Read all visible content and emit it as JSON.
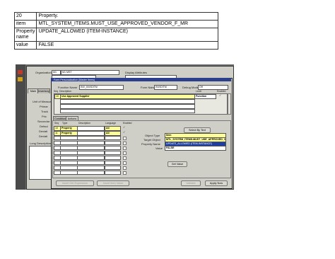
{
  "info_table": [
    {
      "key": "20",
      "value": "Property."
    },
    {
      "key": "item",
      "value": "MTL_SYSTEM_ITEMS.MUST_USE_APPROVED_VENDOR_F_MR"
    },
    {
      "key": "Property name",
      "value": "UPDATE_ALLOWED (ITEM-INSTANCE)"
    },
    {
      "key": "value",
      "value": "FALSE"
    }
  ],
  "back_form": {
    "organization_label": "Organization",
    "organization_code": "M1",
    "organization_value": "M1 MST",
    "display_attributes_label": "Display Attributes",
    "tabs": [
      "Main",
      "Inventory"
    ],
    "left_labels": [
      "Unit of Measure",
      "Primar",
      "Track",
      "Pric",
      "Secondar",
      "Defaul",
      "Deviati",
      "Deviati"
    ],
    "long_description_label": "Long Description",
    "colors": {
      "bg": "#cfcfc8",
      "title_bar": "#2b3f8c"
    }
  },
  "personalization": {
    "title": "Form Personalization (Master Items)",
    "function_name_label": "Function Name",
    "function_name": "INV_INVIDITM",
    "form_name_label": "Form Name",
    "form_name": "INVIDITM",
    "debug_mode_label": "Debug Mode",
    "debug_mode": "Off",
    "rules_headers": [
      "Seq",
      "Description",
      "Level",
      "Enabled"
    ],
    "rules": [
      {
        "seq": "10",
        "description": "Use Approved Supplier",
        "level": "Function",
        "enabled": "✓"
      }
    ],
    "sub_tabs": [
      "Condition",
      "Actions"
    ],
    "actions_headers": [
      "Seq",
      "Type",
      "Description",
      "Language",
      "Enabled"
    ],
    "actions": [
      {
        "seq": "10",
        "type": "Property",
        "description": "",
        "language": "All",
        "enabled": "✓"
      },
      {
        "seq": "11",
        "type": "Property",
        "description": "",
        "language": "All",
        "enabled": "✓"
      }
    ],
    "select_by_text": "Select By Text",
    "object_type_label": "Object Type",
    "object_type": "Item",
    "target_object_label": "Target Object",
    "target_object": "MTL_SYSTEM_ITEMS.MUST_USE_APPROVED_V",
    "property_name_label": "Property Name",
    "property_name": "UPDATE_ALLOWED (ITEM-INSTANCE)",
    "value_label": "Value",
    "value": "FALSE",
    "get_value": "Get Value",
    "bottom_buttons": [
      "Insert Get Expression",
      "Insert Item Value",
      "Validate",
      "Apply Now"
    ],
    "colors": {
      "required": "#ffff99",
      "selected": "#1f3fa0"
    }
  }
}
